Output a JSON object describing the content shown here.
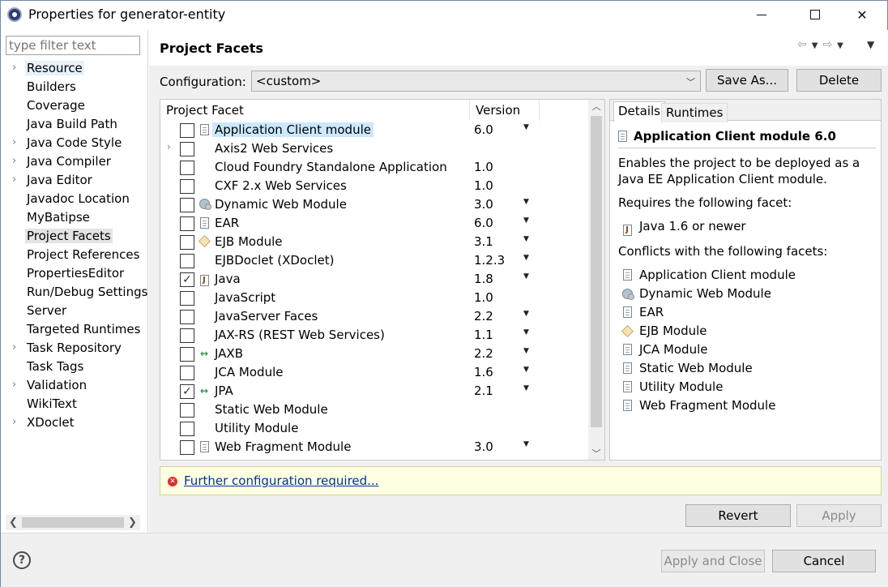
{
  "window": {
    "title": "Properties for generator-entity",
    "icon": "eclipse-icon"
  },
  "left_nav": {
    "filter_placeholder": "type filter text",
    "items": [
      {
        "label": "Resource",
        "expandable": true
      },
      {
        "label": "Builders",
        "expandable": false
      },
      {
        "label": "Coverage",
        "expandable": false
      },
      {
        "label": "Java Build Path",
        "expandable": false
      },
      {
        "label": "Java Code Style",
        "expandable": true
      },
      {
        "label": "Java Compiler",
        "expandable": true
      },
      {
        "label": "Java Editor",
        "expandable": true
      },
      {
        "label": "Javadoc Location",
        "expandable": false
      },
      {
        "label": "MyBatipse",
        "expandable": false
      },
      {
        "label": "Project Facets",
        "expandable": false
      },
      {
        "label": "Project References",
        "expandable": false
      },
      {
        "label": "PropertiesEditor",
        "expandable": false
      },
      {
        "label": "Run/Debug Settings",
        "expandable": false
      },
      {
        "label": "Server",
        "expandable": false
      },
      {
        "label": "Targeted Runtimes",
        "expandable": false
      },
      {
        "label": "Task Repository",
        "expandable": true
      },
      {
        "label": "Task Tags",
        "expandable": false
      },
      {
        "label": "Validation",
        "expandable": true
      },
      {
        "label": "WikiText",
        "expandable": false
      },
      {
        "label": "XDoclet",
        "expandable": true
      }
    ],
    "hovered_item": "Resource",
    "selected_item": "Project Facets"
  },
  "page": {
    "title": "Project Facets",
    "configuration_label": "Configuration:",
    "configuration_value": "<custom>",
    "save_as_label": "Save As...",
    "delete_label": "Delete"
  },
  "facets": {
    "col_facet": "Project Facet",
    "col_version": "Version",
    "rows": [
      {
        "name": "Application Client module",
        "version": "6.0",
        "checked": false,
        "dropdown": true,
        "icon": "doc",
        "expandable": false,
        "highlighted": true
      },
      {
        "name": "Axis2 Web Services",
        "version": "",
        "checked": false,
        "dropdown": false,
        "icon": "none",
        "expandable": true,
        "highlighted": false
      },
      {
        "name": "Cloud Foundry Standalone Application",
        "version": "1.0",
        "checked": false,
        "dropdown": false,
        "icon": "none",
        "expandable": false,
        "highlighted": false
      },
      {
        "name": "CXF 2.x Web Services",
        "version": "1.0",
        "checked": false,
        "dropdown": false,
        "icon": "none",
        "expandable": false,
        "highlighted": false
      },
      {
        "name": "Dynamic Web Module",
        "version": "3.0",
        "checked": false,
        "dropdown": true,
        "icon": "web",
        "expandable": false,
        "highlighted": false
      },
      {
        "name": "EAR",
        "version": "6.0",
        "checked": false,
        "dropdown": true,
        "icon": "doc",
        "expandable": false,
        "highlighted": false
      },
      {
        "name": "EJB Module",
        "version": "3.1",
        "checked": false,
        "dropdown": true,
        "icon": "ejb",
        "expandable": false,
        "highlighted": false
      },
      {
        "name": "EJBDoclet (XDoclet)",
        "version": "1.2.3",
        "checked": false,
        "dropdown": true,
        "icon": "none",
        "expandable": false,
        "highlighted": false
      },
      {
        "name": "Java",
        "version": "1.8",
        "checked": true,
        "dropdown": true,
        "icon": "java",
        "expandable": false,
        "highlighted": false
      },
      {
        "name": "JavaScript",
        "version": "1.0",
        "checked": false,
        "dropdown": false,
        "icon": "none",
        "expandable": false,
        "highlighted": false
      },
      {
        "name": "JavaServer Faces",
        "version": "2.2",
        "checked": false,
        "dropdown": true,
        "icon": "none",
        "expandable": false,
        "highlighted": false
      },
      {
        "name": "JAX-RS (REST Web Services)",
        "version": "1.1",
        "checked": false,
        "dropdown": true,
        "icon": "none",
        "expandable": false,
        "highlighted": false
      },
      {
        "name": "JAXB",
        "version": "2.2",
        "checked": false,
        "dropdown": true,
        "icon": "arrows",
        "expandable": false,
        "highlighted": false
      },
      {
        "name": "JCA Module",
        "version": "1.6",
        "checked": false,
        "dropdown": true,
        "icon": "none",
        "expandable": false,
        "highlighted": false
      },
      {
        "name": "JPA",
        "version": "2.1",
        "checked": true,
        "dropdown": true,
        "icon": "arrows",
        "expandable": false,
        "highlighted": false
      },
      {
        "name": "Static Web Module",
        "version": "",
        "checked": false,
        "dropdown": false,
        "icon": "none",
        "expandable": false,
        "highlighted": false
      },
      {
        "name": "Utility Module",
        "version": "",
        "checked": false,
        "dropdown": false,
        "icon": "none",
        "expandable": false,
        "highlighted": false
      },
      {
        "name": "Web Fragment Module",
        "version": "3.0",
        "checked": false,
        "dropdown": true,
        "icon": "doc",
        "expandable": false,
        "highlighted": false
      }
    ]
  },
  "details": {
    "tab_details": "Details",
    "tab_runtimes": "Runtimes",
    "heading": "Application Client module 6.0",
    "description": "Enables the project to be deployed as a Java EE Application Client module.",
    "requires_label": "Requires the following facet:",
    "requires": [
      {
        "label": "Java 1.6 or newer",
        "icon": "java"
      }
    ],
    "conflicts_label": "Conflicts with the following facets:",
    "conflicts": [
      {
        "label": "Application Client module",
        "icon": "doc"
      },
      {
        "label": "Dynamic Web Module",
        "icon": "web"
      },
      {
        "label": "EAR",
        "icon": "doc"
      },
      {
        "label": "EJB Module",
        "icon": "ejb"
      },
      {
        "label": "JCA Module",
        "icon": "doc"
      },
      {
        "label": "Static Web Module",
        "icon": "doc"
      },
      {
        "label": "Utility Module",
        "icon": "doc"
      },
      {
        "label": "Web Fragment Module",
        "icon": "doc"
      }
    ]
  },
  "warning": {
    "link_text": "Further configuration required..."
  },
  "buttons": {
    "revert": "Revert",
    "apply": "Apply",
    "apply_and_close": "Apply and Close",
    "cancel": "Cancel",
    "help": "?"
  },
  "colors": {
    "hover_highlight": "#e5f1fb",
    "selected_highlight": "#e4e4e4",
    "row_highlight": "#cce8ff",
    "warning_bg": "#ffffe1",
    "link": "#0033a0",
    "error": "#d9312c"
  }
}
